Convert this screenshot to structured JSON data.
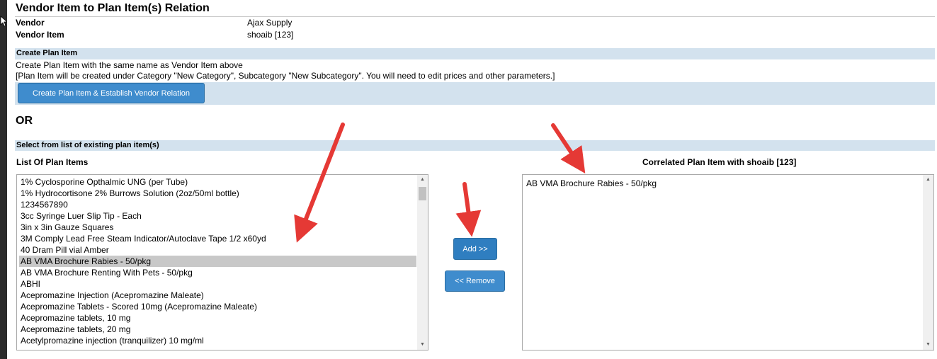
{
  "header": {
    "title": "Vendor Item to Plan Item(s) Relation",
    "vendor_label": "Vendor",
    "vendor_value": "Ajax Supply",
    "vendor_item_label": "Vendor Item",
    "vendor_item_value": "shoaib [123]"
  },
  "create_section": {
    "band_title": "Create Plan Item",
    "line1": "Create Plan Item with the same name as Vendor Item above",
    "line2": "[Plan Item will be created under Category \"New Category\", Subcategory \"New Subcategory\". You will need to edit prices and other parameters.]",
    "button_label": "Create Plan Item & Establish Vendor Relation"
  },
  "or_label": "OR",
  "select_section": {
    "band_title": "Select from list of existing plan item(s)",
    "list_heading": "List Of Plan Items",
    "correlated_heading": "Correlated Plan Item with shoaib [123]",
    "plan_items": [
      "1% Cyclosporine Opthalmic UNG (per Tube)",
      "1% Hydrocortisone 2% Burrows Solution (2oz/50ml bottle)",
      "1234567890",
      "3cc Syringe Luer Slip Tip - Each",
      "3in x 3in Gauze Squares",
      "3M Comply Lead Free Steam Indicator/Autoclave Tape 1/2 x60yd",
      "40 Dram Pill vial Amber",
      "AB VMA Brochure Rabies - 50/pkg",
      "AB VMA Brochure Renting With Pets - 50/pkg",
      "ABHI",
      "Acepromazine Injection (Acepromazine Maleate)",
      "Acepromazine Tablets - Scored 10mg (Acepromazine Maleate)",
      "Acepromazine tablets, 10 mg",
      "Acepromazine tablets, 20 mg",
      "Acetylpromazine injection (tranquilizer) 10 mg/ml"
    ],
    "selected_index": 7,
    "correlated_items": [
      "AB VMA Brochure Rabies - 50/pkg"
    ],
    "add_label": "Add >>",
    "remove_label": "<< Remove"
  },
  "colors": {
    "band": "#d3e2ee",
    "button": "#3f8ccd",
    "selection": "#c8c8c8",
    "annotation_arrow": "#e53935"
  },
  "icons": {
    "scroll_up": "▲",
    "scroll_down": "▼"
  }
}
